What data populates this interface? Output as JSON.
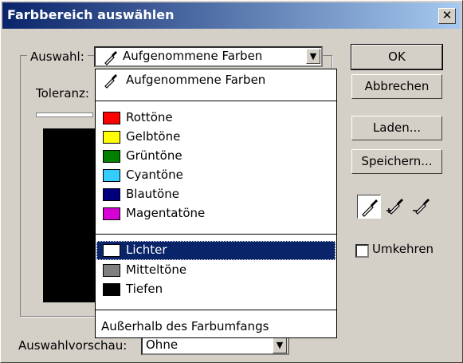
{
  "window": {
    "title": "Farbbereich auswählen",
    "close_label": "✕"
  },
  "selection": {
    "label": "Auswahl:",
    "value": "Aufgenommene Farben",
    "icon": "eyedropper-icon"
  },
  "tolerance": {
    "label": "Toleranz:"
  },
  "preview": {
    "label": "Auswahlvorschau:",
    "value": "Ohne"
  },
  "buttons": {
    "ok": "OK",
    "cancel": "Abbrechen",
    "load": "Laden...",
    "save": "Speichern..."
  },
  "tools": [
    "eyedropper-icon",
    "eyedropper-plus-icon",
    "eyedropper-minus-icon"
  ],
  "invert": {
    "label": "Umkehren",
    "checked": false
  },
  "dropdown": {
    "top": "Aufgenommene Farben",
    "colors": [
      {
        "label": "Rottöne",
        "color": "#ff0000"
      },
      {
        "label": "Gelbtöne",
        "color": "#ffff00"
      },
      {
        "label": "Grüntöne",
        "color": "#007f00"
      },
      {
        "label": "Cyantöne",
        "color": "#33ccff"
      },
      {
        "label": "Blautöne",
        "color": "#00007f"
      },
      {
        "label": "Magentatöne",
        "color": "#d400d4"
      }
    ],
    "tones": [
      {
        "label": "Lichter",
        "color": "#ffffff",
        "selected": true
      },
      {
        "label": "Mitteltöne",
        "color": "#808080",
        "selected": false
      },
      {
        "label": "Tiefen",
        "color": "#000000",
        "selected": false
      }
    ],
    "outside": "Außerhalb des Farbumfangs"
  }
}
